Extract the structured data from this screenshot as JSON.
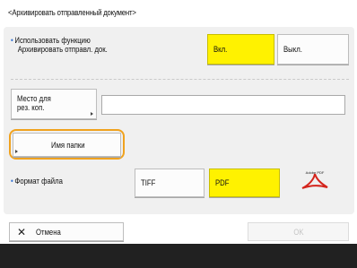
{
  "header": {
    "title": "<Архивировать отправленный документ>"
  },
  "archive_setting": {
    "label_line1": "Использовать функцию",
    "label_line2": "Архивировать отправл. док.",
    "on_label": "Вкл.",
    "off_label": "Выкл.",
    "selected": "on"
  },
  "save_location": {
    "button_label_line1": "Место для",
    "button_label_line2": "рез. коп.",
    "value": ""
  },
  "folder_name": {
    "button_label": "Имя папки"
  },
  "file_format": {
    "label": "Формат файла",
    "options": [
      "TIFF",
      "PDF"
    ],
    "selected": "PDF",
    "pdf_icon_text": "Adobe PDF"
  },
  "footer": {
    "cancel_label": "Отмена",
    "ok_label": "OK"
  },
  "colors": {
    "selected": "#fff200",
    "focus": "#f0a21e",
    "bullet": "#2f6fd1"
  }
}
